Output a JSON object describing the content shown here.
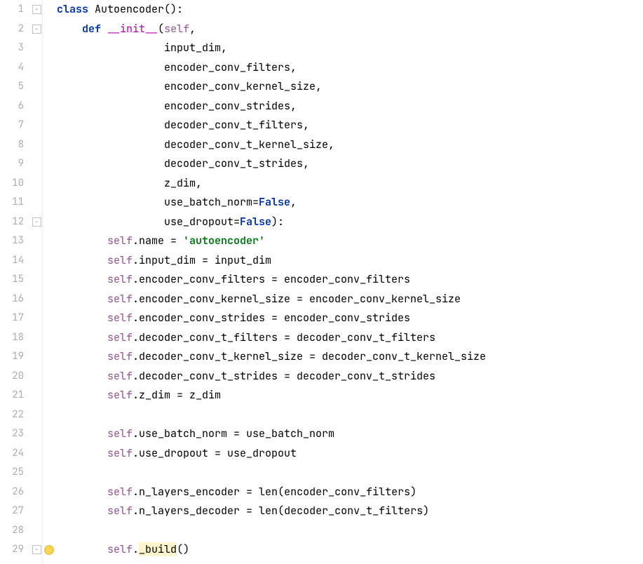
{
  "lines": [
    {
      "n": 1,
      "fold": "start",
      "tokens": [
        {
          "t": "class ",
          "c": "kw"
        },
        {
          "t": "Autoencoder():"
        }
      ]
    },
    {
      "n": 2,
      "fold": "start",
      "tokens": [
        {
          "t": "    "
        },
        {
          "t": "def ",
          "c": "kw"
        },
        {
          "t": "__init__",
          "c": "fn"
        },
        {
          "t": "("
        },
        {
          "t": "self",
          "c": "self"
        },
        {
          "t": ","
        }
      ]
    },
    {
      "n": 3,
      "tokens": [
        {
          "t": "                 input_dim,"
        }
      ]
    },
    {
      "n": 4,
      "tokens": [
        {
          "t": "                 encoder_conv_filters,"
        }
      ]
    },
    {
      "n": 5,
      "tokens": [
        {
          "t": "                 encoder_conv_kernel_size,"
        }
      ]
    },
    {
      "n": 6,
      "tokens": [
        {
          "t": "                 encoder_conv_strides,"
        }
      ]
    },
    {
      "n": 7,
      "tokens": [
        {
          "t": "                 decoder_conv_t_filters,"
        }
      ]
    },
    {
      "n": 8,
      "tokens": [
        {
          "t": "                 decoder_conv_t_kernel_size,"
        }
      ]
    },
    {
      "n": 9,
      "tokens": [
        {
          "t": "                 decoder_conv_t_strides,"
        }
      ]
    },
    {
      "n": 10,
      "tokens": [
        {
          "t": "                 z_dim,"
        }
      ]
    },
    {
      "n": 11,
      "tokens": [
        {
          "t": "                 use_batch_norm="
        },
        {
          "t": "False",
          "c": "bool"
        },
        {
          "t": ","
        }
      ]
    },
    {
      "n": 12,
      "fold": "end",
      "tokens": [
        {
          "t": "                 use_dropout="
        },
        {
          "t": "False",
          "c": "bool"
        },
        {
          "t": "):"
        }
      ]
    },
    {
      "n": 13,
      "tokens": [
        {
          "t": "        "
        },
        {
          "t": "self",
          "c": "self"
        },
        {
          "t": ".name = "
        },
        {
          "t": "'autoencoder'",
          "c": "str"
        }
      ]
    },
    {
      "n": 14,
      "tokens": [
        {
          "t": "        "
        },
        {
          "t": "self",
          "c": "self"
        },
        {
          "t": ".input_dim = input_dim"
        }
      ]
    },
    {
      "n": 15,
      "tokens": [
        {
          "t": "        "
        },
        {
          "t": "self",
          "c": "self"
        },
        {
          "t": ".encoder_conv_filters = encoder_conv_filters"
        }
      ]
    },
    {
      "n": 16,
      "tokens": [
        {
          "t": "        "
        },
        {
          "t": "self",
          "c": "self"
        },
        {
          "t": ".encoder_conv_kernel_size = encoder_conv_kernel_size"
        }
      ]
    },
    {
      "n": 17,
      "tokens": [
        {
          "t": "        "
        },
        {
          "t": "self",
          "c": "self"
        },
        {
          "t": ".encoder_conv_strides = encoder_conv_strides"
        }
      ]
    },
    {
      "n": 18,
      "tokens": [
        {
          "t": "        "
        },
        {
          "t": "self",
          "c": "self"
        },
        {
          "t": ".decoder_conv_t_filters = decoder_conv_t_filters"
        }
      ]
    },
    {
      "n": 19,
      "tokens": [
        {
          "t": "        "
        },
        {
          "t": "self",
          "c": "self"
        },
        {
          "t": ".decoder_conv_t_kernel_size = decoder_conv_t_kernel_size"
        }
      ]
    },
    {
      "n": 20,
      "tokens": [
        {
          "t": "        "
        },
        {
          "t": "self",
          "c": "self"
        },
        {
          "t": ".decoder_conv_t_strides = decoder_conv_t_strides"
        }
      ]
    },
    {
      "n": 21,
      "tokens": [
        {
          "t": "        "
        },
        {
          "t": "self",
          "c": "self"
        },
        {
          "t": ".z_dim = z_dim"
        }
      ]
    },
    {
      "n": 22,
      "tokens": [
        {
          "t": ""
        }
      ]
    },
    {
      "n": 23,
      "tokens": [
        {
          "t": "        "
        },
        {
          "t": "self",
          "c": "self"
        },
        {
          "t": ".use_batch_norm = use_batch_norm"
        }
      ]
    },
    {
      "n": 24,
      "tokens": [
        {
          "t": "        "
        },
        {
          "t": "self",
          "c": "self"
        },
        {
          "t": ".use_dropout = use_dropout"
        }
      ]
    },
    {
      "n": 25,
      "tokens": [
        {
          "t": ""
        }
      ]
    },
    {
      "n": 26,
      "tokens": [
        {
          "t": "        "
        },
        {
          "t": "self",
          "c": "self"
        },
        {
          "t": ".n_layers_encoder = "
        },
        {
          "t": "len",
          "c": "builtin"
        },
        {
          "t": "(encoder_conv_filters)"
        }
      ]
    },
    {
      "n": 27,
      "tokens": [
        {
          "t": "        "
        },
        {
          "t": "self",
          "c": "self"
        },
        {
          "t": ".n_layers_decoder = "
        },
        {
          "t": "len",
          "c": "builtin"
        },
        {
          "t": "(decoder_conv_t_filters)"
        }
      ]
    },
    {
      "n": 28,
      "tokens": [
        {
          "t": ""
        }
      ]
    },
    {
      "n": 29,
      "fold": "start",
      "bulb": true,
      "tokens": [
        {
          "t": "        "
        },
        {
          "t": "self",
          "c": "self"
        },
        {
          "t": "."
        },
        {
          "t": "_build",
          "c": "hl"
        },
        {
          "t": "()"
        }
      ]
    }
  ]
}
